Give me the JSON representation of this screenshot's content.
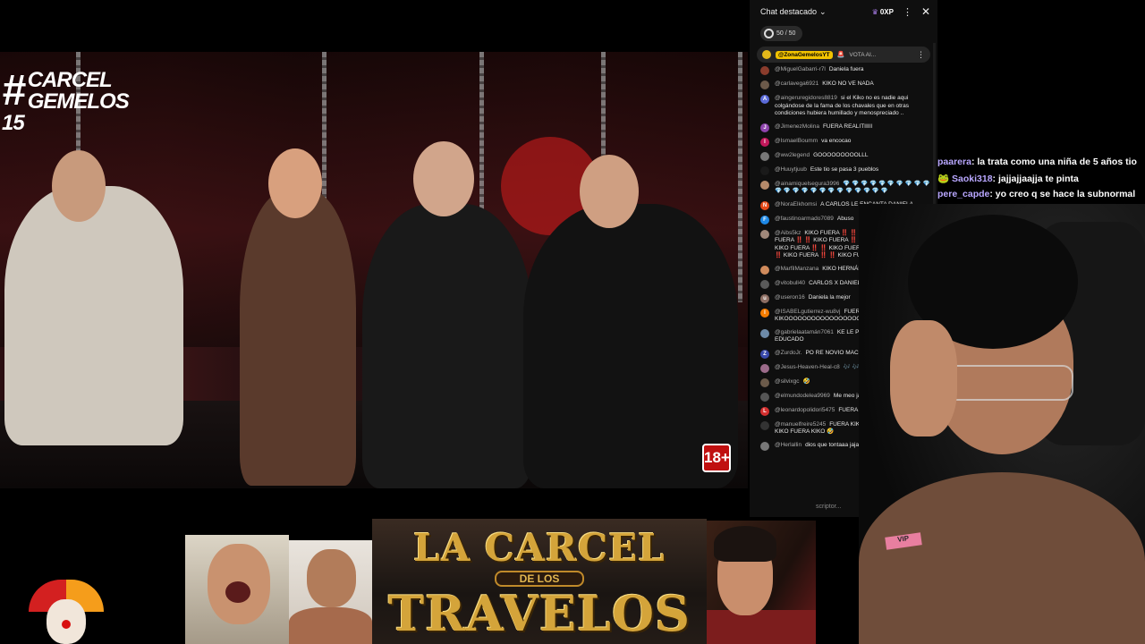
{
  "video": {
    "logo_hash": "#",
    "logo_line1": "CARCEL",
    "logo_line2": "GEMELOS 15",
    "rating_badge": "18+"
  },
  "chat": {
    "title": "Chat destacado",
    "xp_label": "0XP",
    "counter": "50 / 50",
    "pinned_author": "@ZonaGemelosYT",
    "pinned_text": "VOTA AI...",
    "input_placeholder": "scriptor...",
    "messages": [
      {
        "author": "@MiguelGabarri-r7l",
        "text": "Daniela fuera",
        "color": "#8a3c2c",
        "initial": ""
      },
      {
        "author": "@carlavega6921",
        "text": "KIKO NO VE NADA",
        "color": "#6c5a4a",
        "initial": ""
      },
      {
        "author": "@aingeruregidores8819",
        "text": "si el Kiko no es nadie aqui colgándose de la fama de los chavales que en otras condiciones hubiera humillado y menospreciado ..",
        "color": "#5a6ad8",
        "initial": "A"
      },
      {
        "author": "@JimenezMolina",
        "text": "FUERA REALITIIIII",
        "color": "#8e44ad",
        "initial": "J"
      },
      {
        "author": "@IsmaelBoumm",
        "text": "va encocao",
        "color": "#c2185b",
        "initial": "I"
      },
      {
        "author": "@ww2legend",
        "text": "GOOOOOOOOOLLL",
        "color": "#777",
        "initial": ""
      },
      {
        "author": "@Huuytjuub",
        "text": "Este tio se pasa 3 pueblos",
        "color": "#1a1a1a",
        "initial": ""
      },
      {
        "author": "@ainamiquelsegura3996",
        "text": "💎 💎 💎 💎 💎 💎 💎 💎 💎 💎 💎 💎 💎 💎 💎 💎 💎 💎 💎 💎 💎 💎 💎",
        "color": "#b58a6a",
        "initial": ""
      },
      {
        "author": "@NoraElkhomsi",
        "text": "A CARLOS LE ENCANTA DANIELA",
        "color": "#e64a19",
        "initial": "N"
      },
      {
        "author": "@faustinoarmado7089",
        "text": "Abuso",
        "color": "#1e88e5",
        "initial": "F"
      },
      {
        "author": "@Aibs5kz",
        "text": "KIKO FUERA ‼️ ‼️ KIKO FUERA ‼️ ‼️ KIKO FUERA ‼️ ‼️ KIKO FUERA ‼️ ‼️ KIKO FUERA ‼️ ‼️ KIKO FUERA ‼️ ‼️ KIKO FUERA ‼️ ‼️ KIKO FUERA ‼️ ‼️ KIKO FUERA ‼️ ‼️ KIKO FUERA",
        "color": "#a0887a",
        "initial": ""
      },
      {
        "author": "@MarfilManzana",
        "text": "KIKO HERNÁNDEZ, SOBRAS",
        "color": "#d08b5c",
        "initial": ""
      },
      {
        "author": "@vitobull40",
        "text": "CARLOS X DANIELA",
        "color": "#5a5a5a",
        "initial": ""
      },
      {
        "author": "@useron16",
        "text": "Daniela la mejor",
        "color": "#8d6e63",
        "initial": "u"
      },
      {
        "author": "@ISABELgutierrez-wu8vj",
        "text": "FUERA KIKOOOOOOOOOOOOOOOOOOOOOOOOOO",
        "color": "#f57c00",
        "initial": "I"
      },
      {
        "author": "@gabrielaatamán7061",
        "text": "KE LE PASA A KIKO NO ES EDUCADO",
        "color": "#6d8aa8",
        "initial": ""
      },
      {
        "author": "@ZurdoJr.",
        "text": "PO RE NOVIO MACHO AJJA",
        "color": "#3949ab",
        "initial": "Z"
      },
      {
        "author": "@Jesus-Heaven-Heal-c8",
        "text": "🎶 🎶 🎶",
        "color": "#9c6b8a",
        "initial": ""
      },
      {
        "author": "@silvixgc",
        "text": "🤣",
        "color": "#6b5a4a",
        "initial": ""
      },
      {
        "author": "@elmundodelea9969",
        "text": "Me meo jajajaja",
        "color": "#555",
        "initial": ""
      },
      {
        "author": "@leonardopolidori5475",
        "text": "FUERA KIKO",
        "color": "#d32f2f",
        "initial": "L"
      },
      {
        "author": "@manuelfreire5245",
        "text": "FUERA KIKO FUERA KIKO FUERA KIKO FUERA KIKO 🤣",
        "color": "#333",
        "initial": ""
      },
      {
        "author": "@Herlallin",
        "text": "dios que tontaaa jaja",
        "color": "#777",
        "initial": ""
      }
    ]
  },
  "twitch": {
    "lines": [
      {
        "user": "paarera",
        "text": ": la trata como una niña de 5 años tio"
      },
      {
        "user": "Saoki318",
        "text": ": jajjajjaajja te pinta"
      },
      {
        "user": "pere_capde",
        "text": ": yo creo q se hace la subnormal"
      }
    ]
  },
  "bottom": {
    "title_line1": "LA CARCEL",
    "title_line2": "DE LOS",
    "title_line3": "TRAVELOS"
  },
  "webcam": {
    "wristband_text": "VIP"
  }
}
